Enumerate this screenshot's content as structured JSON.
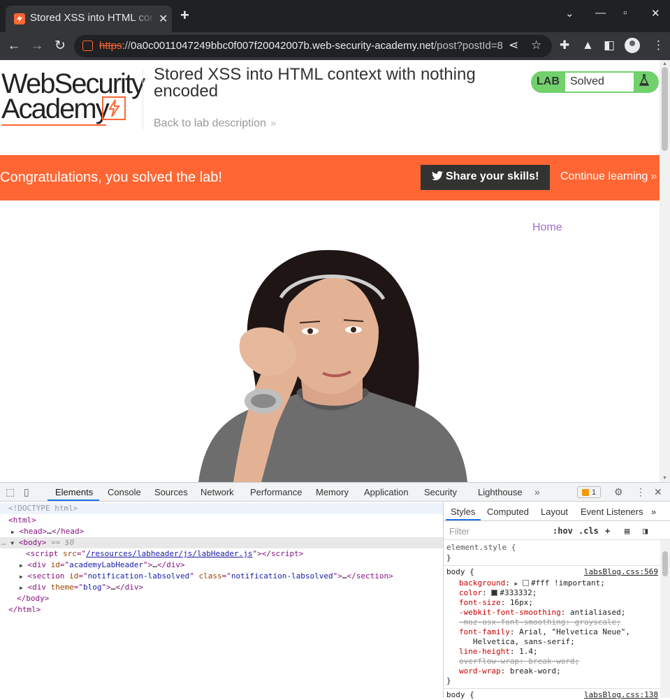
{
  "browser": {
    "tab_title": "Stored XSS into HTML con",
    "url_scheme": "https",
    "url_host": "0a0c0011047249bbc0f007f20042007b.web-security-academy.net",
    "url_path": "/post?postId=8"
  },
  "page": {
    "logo_line1": "WebSecurity",
    "logo_line2": "Academy",
    "lab_title": "Stored XSS into HTML context with nothing encoded",
    "back_link": "Back to lab description",
    "lab_badge": "LAB",
    "lab_status": "Solved",
    "banner_message": "Congratulations, you solved the lab!",
    "share_button": "Share your skills!",
    "continue_link": "Continue learning",
    "nav_home": "Home",
    "accent_color": "#ff6633",
    "status_color": "#70d16d"
  },
  "devtools": {
    "tabs": [
      "Elements",
      "Console",
      "Sources",
      "Network",
      "Performance",
      "Memory",
      "Application",
      "Security",
      "Lighthouse"
    ],
    "issues_count": "1",
    "dom": {
      "doctype": "<!DOCTYPE html>",
      "html_open": "<html>",
      "head": "head",
      "head_ellipsis": "…",
      "body": "body",
      "body_eq": "== $0",
      "script_src_attr": "src",
      "script_src": "/resources/labheader/js/labHeader.js",
      "div1_id": "academyLabHeader",
      "section_id": "notification-labsolved",
      "section_class": "notification-labsolved",
      "div2_theme": "blog",
      "body_close": "</body>",
      "html_close": "</html>"
    },
    "styles": {
      "tabs": [
        "Styles",
        "Computed",
        "Layout",
        "Event Listeners"
      ],
      "filter_placeholder": "Filter",
      "hov": ":hov",
      "cls": ".cls",
      "element_style": "element.style {",
      "close_brace": "}",
      "rule1_selector": "body {",
      "rule1_source": "labsBlog.css:569",
      "rule2_selector": "body {",
      "rule2_source": "labsBlog.css:138",
      "props": [
        {
          "name": "background",
          "value": "#fff !important;",
          "struck": false,
          "swatch": "#ffffff"
        },
        {
          "name": "color",
          "value": "#333332;",
          "struck": false,
          "swatch": "#333332"
        },
        {
          "name": "font-size",
          "value": "16px;",
          "struck": false
        },
        {
          "name": "-webkit-font-smoothing",
          "value": "antialiased;",
          "struck": false
        },
        {
          "name": "-moz-osx-font-smoothing",
          "value": "grayscale;",
          "struck": true
        },
        {
          "name": "font-family",
          "value": "Arial, \"Helvetica Neue\",",
          "struck": false
        },
        {
          "name": "",
          "value": "Helvetica, sans-serif;",
          "struck": false
        },
        {
          "name": "line-height",
          "value": "1.4;",
          "struck": false
        },
        {
          "name": "overflow-wrap",
          "value": "break-word;",
          "struck": true
        },
        {
          "name": "word-wrap",
          "value": "break-word;",
          "struck": false
        }
      ]
    }
  }
}
